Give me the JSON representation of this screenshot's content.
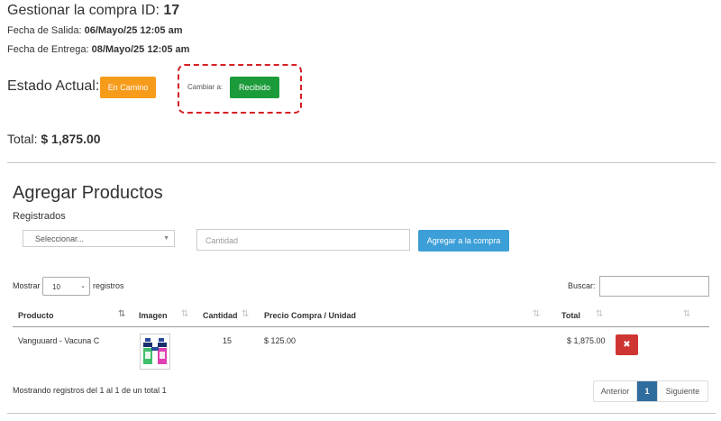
{
  "header": {
    "title_prefix": "Gestionar la compra ID:",
    "compra_id": "17",
    "salida_label": "Fecha de Salida:",
    "salida_value": "06/Mayo/25 12:05 am",
    "entrega_label": "Fecha de Entrega:",
    "entrega_value": "08/Mayo/25 12:05 am"
  },
  "status": {
    "label": "Estado Actual:",
    "current": "En Camino",
    "change_label": "Cambiar a:",
    "change_to": "Recibido",
    "colors": {
      "en_camino": "#f79b1b",
      "recibido": "#1c9b3a",
      "highlight": "#d42025"
    }
  },
  "total": {
    "label": "Total:",
    "value": "$ 1,875.00"
  },
  "add_products": {
    "title": "Agregar Productos",
    "subtitle": "Registrados",
    "select_placeholder": "Seleccionar...",
    "qty_placeholder": "Cantidad",
    "add_button": "Agregar a la compra"
  },
  "table_controls": {
    "show_label": "Mostrar",
    "page_length": "10",
    "records_label": "registros",
    "search_label": "Buscar:"
  },
  "table": {
    "columns": [
      "Producto",
      "Imagen",
      "Cantidad",
      "Precio Compra / Unidad",
      "Total"
    ],
    "rows": [
      {
        "producto": "Vanguuard - Vacuna C",
        "imagen": "product-thumbnail",
        "cantidad": "15",
        "precio": "$ 125.00",
        "total": "$ 1,875.00"
      }
    ]
  },
  "footer": {
    "info": "Mostrando registros del 1 al 1 de un total 1",
    "prev": "Anterior",
    "page": "1",
    "next": "Siguiente"
  }
}
